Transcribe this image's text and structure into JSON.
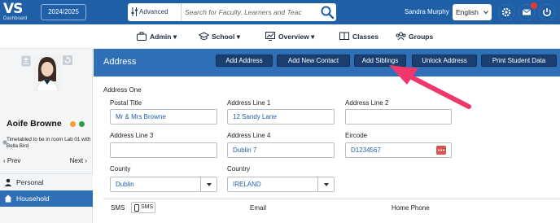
{
  "header": {
    "logo_text": "VS",
    "logo_sub": "Dashboard",
    "year": "2024/2025",
    "advanced_label": "Advanced",
    "search_placeholder": "Search for Faculty, Learners and Teac",
    "user_name": "Sandra Murphy",
    "language": "English"
  },
  "nav": {
    "items": [
      {
        "label": "Admin",
        "icon": "briefcase-icon"
      },
      {
        "label": "School",
        "icon": "graduation-cap-icon"
      },
      {
        "label": "Overview",
        "icon": "chart-icon"
      },
      {
        "label": "Classes",
        "icon": "classes-icon"
      },
      {
        "label": "Groups",
        "icon": "groups-icon"
      }
    ]
  },
  "student": {
    "name": "Aoife Browne",
    "status_colors": [
      "#f0a030",
      "#2e9e3e"
    ],
    "timetable_note": "Timetabled to be in room Lab 01 with Bella Bird",
    "prev_label": "Prev",
    "next_label": "Next"
  },
  "sidebar": {
    "items": [
      {
        "label": "Personal",
        "active": false
      },
      {
        "label": "Household",
        "active": true
      }
    ]
  },
  "main": {
    "title": "Address",
    "actions": [
      "Add Address",
      "Add New Contact",
      "Add Siblings",
      "Unlock Address",
      "Print Student Data"
    ],
    "section_title": "Address One",
    "fields": {
      "postal_title": {
        "label": "Postal Title",
        "value": "Mr & Mrs Browne"
      },
      "address_line_1": {
        "label": "Address Line 1",
        "value": "12 Sandy Lane"
      },
      "address_line_2": {
        "label": "Address Line 2",
        "value": ""
      },
      "address_line_3": {
        "label": "Address Line 3",
        "value": ""
      },
      "address_line_4": {
        "label": "Address Line 4",
        "value": "Dublin 7"
      },
      "eircode": {
        "label": "Eircode",
        "value": "D1234567"
      },
      "county": {
        "label": "County",
        "value": "Dublin"
      },
      "country": {
        "label": "Country",
        "value": "IRELAND"
      }
    },
    "table_headers": {
      "sms": "SMS",
      "sms_button": "SMS",
      "email": "Email",
      "home_phone": "Home Phone"
    }
  },
  "colors": {
    "topbar": "#1f5fa6",
    "header": "#2f6fb6",
    "action_button": "#1b3f70",
    "active_sidebar": "#2f6fb6",
    "annotation_arrow": "#f0376c"
  }
}
